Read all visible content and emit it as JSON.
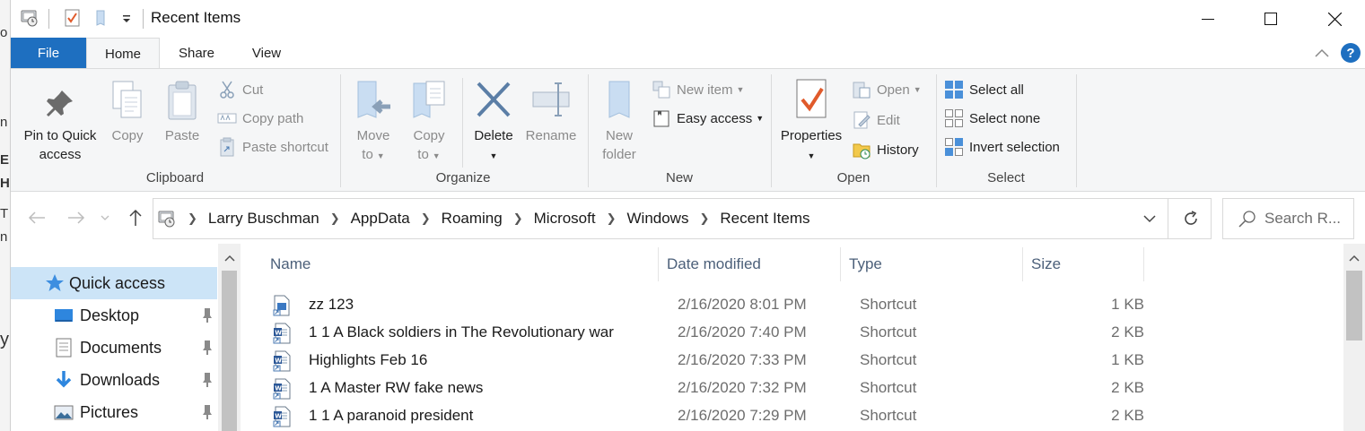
{
  "window": {
    "title": "Recent Items"
  },
  "ribbon_tabs": {
    "file": "File",
    "home": "Home",
    "share": "Share",
    "view": "View"
  },
  "clipboard": {
    "label": "Clipboard",
    "pin_line1": "Pin to Quick",
    "pin_line2": "access",
    "copy": "Copy",
    "paste": "Paste",
    "cut": "Cut",
    "copy_path": "Copy path",
    "paste_shortcut": "Paste shortcut"
  },
  "organize": {
    "label": "Organize",
    "move_line1": "Move",
    "move_line2": "to",
    "copy_line1": "Copy",
    "copy_line2": "to",
    "delete": "Delete",
    "rename": "Rename"
  },
  "new": {
    "label": "New",
    "folder_line1": "New",
    "folder_line2": "folder",
    "new_item": "New item",
    "easy_access": "Easy access"
  },
  "open": {
    "label": "Open",
    "properties": "Properties",
    "open": "Open",
    "edit": "Edit",
    "history": "History"
  },
  "select": {
    "label": "Select",
    "select_all": "Select all",
    "select_none": "Select none",
    "invert": "Invert selection"
  },
  "address": {
    "crumbs": [
      "Larry Buschman",
      "AppData",
      "Roaming",
      "Microsoft",
      "Windows",
      "Recent Items"
    ],
    "search_placeholder": "Search R..."
  },
  "nav": {
    "items": [
      {
        "label": "Quick access",
        "icon": "star-icon",
        "selected": true,
        "pinned": false
      },
      {
        "label": "Desktop",
        "icon": "desktop-icon",
        "selected": false,
        "pinned": true
      },
      {
        "label": "Documents",
        "icon": "documents-icon",
        "selected": false,
        "pinned": true
      },
      {
        "label": "Downloads",
        "icon": "download-arrow-icon",
        "selected": false,
        "pinned": true
      },
      {
        "label": "Pictures",
        "icon": "pictures-icon",
        "selected": false,
        "pinned": true
      }
    ]
  },
  "columns": {
    "name": "Name",
    "date": "Date modified",
    "type": "Type",
    "size": "Size"
  },
  "files": [
    {
      "name": "zz 123",
      "date": "2/16/2020 8:01 PM",
      "type": "Shortcut",
      "size": "1 KB",
      "icon": "image-shortcut-icon"
    },
    {
      "name": "1 1 A Black soldiers in The Revolutionary war",
      "date": "2/16/2020 7:40 PM",
      "type": "Shortcut",
      "size": "2 KB",
      "icon": "word-doc-icon"
    },
    {
      "name": "Highlights Feb 16",
      "date": "2/16/2020 7:33 PM",
      "type": "Shortcut",
      "size": "1 KB",
      "icon": "word-doc-icon"
    },
    {
      "name": "1 A Master RW fake news",
      "date": "2/16/2020 7:32 PM",
      "type": "Shortcut",
      "size": "2 KB",
      "icon": "word-doc-icon"
    },
    {
      "name": "1 1 A paranoid president",
      "date": "2/16/2020 7:29 PM",
      "type": "Shortcut",
      "size": "2 KB",
      "icon": "word-doc-icon"
    }
  ],
  "colors": {
    "accent": "#1e6fc0",
    "selection": "#cce4f7",
    "ribbon_bg": "#f5f6f7"
  }
}
